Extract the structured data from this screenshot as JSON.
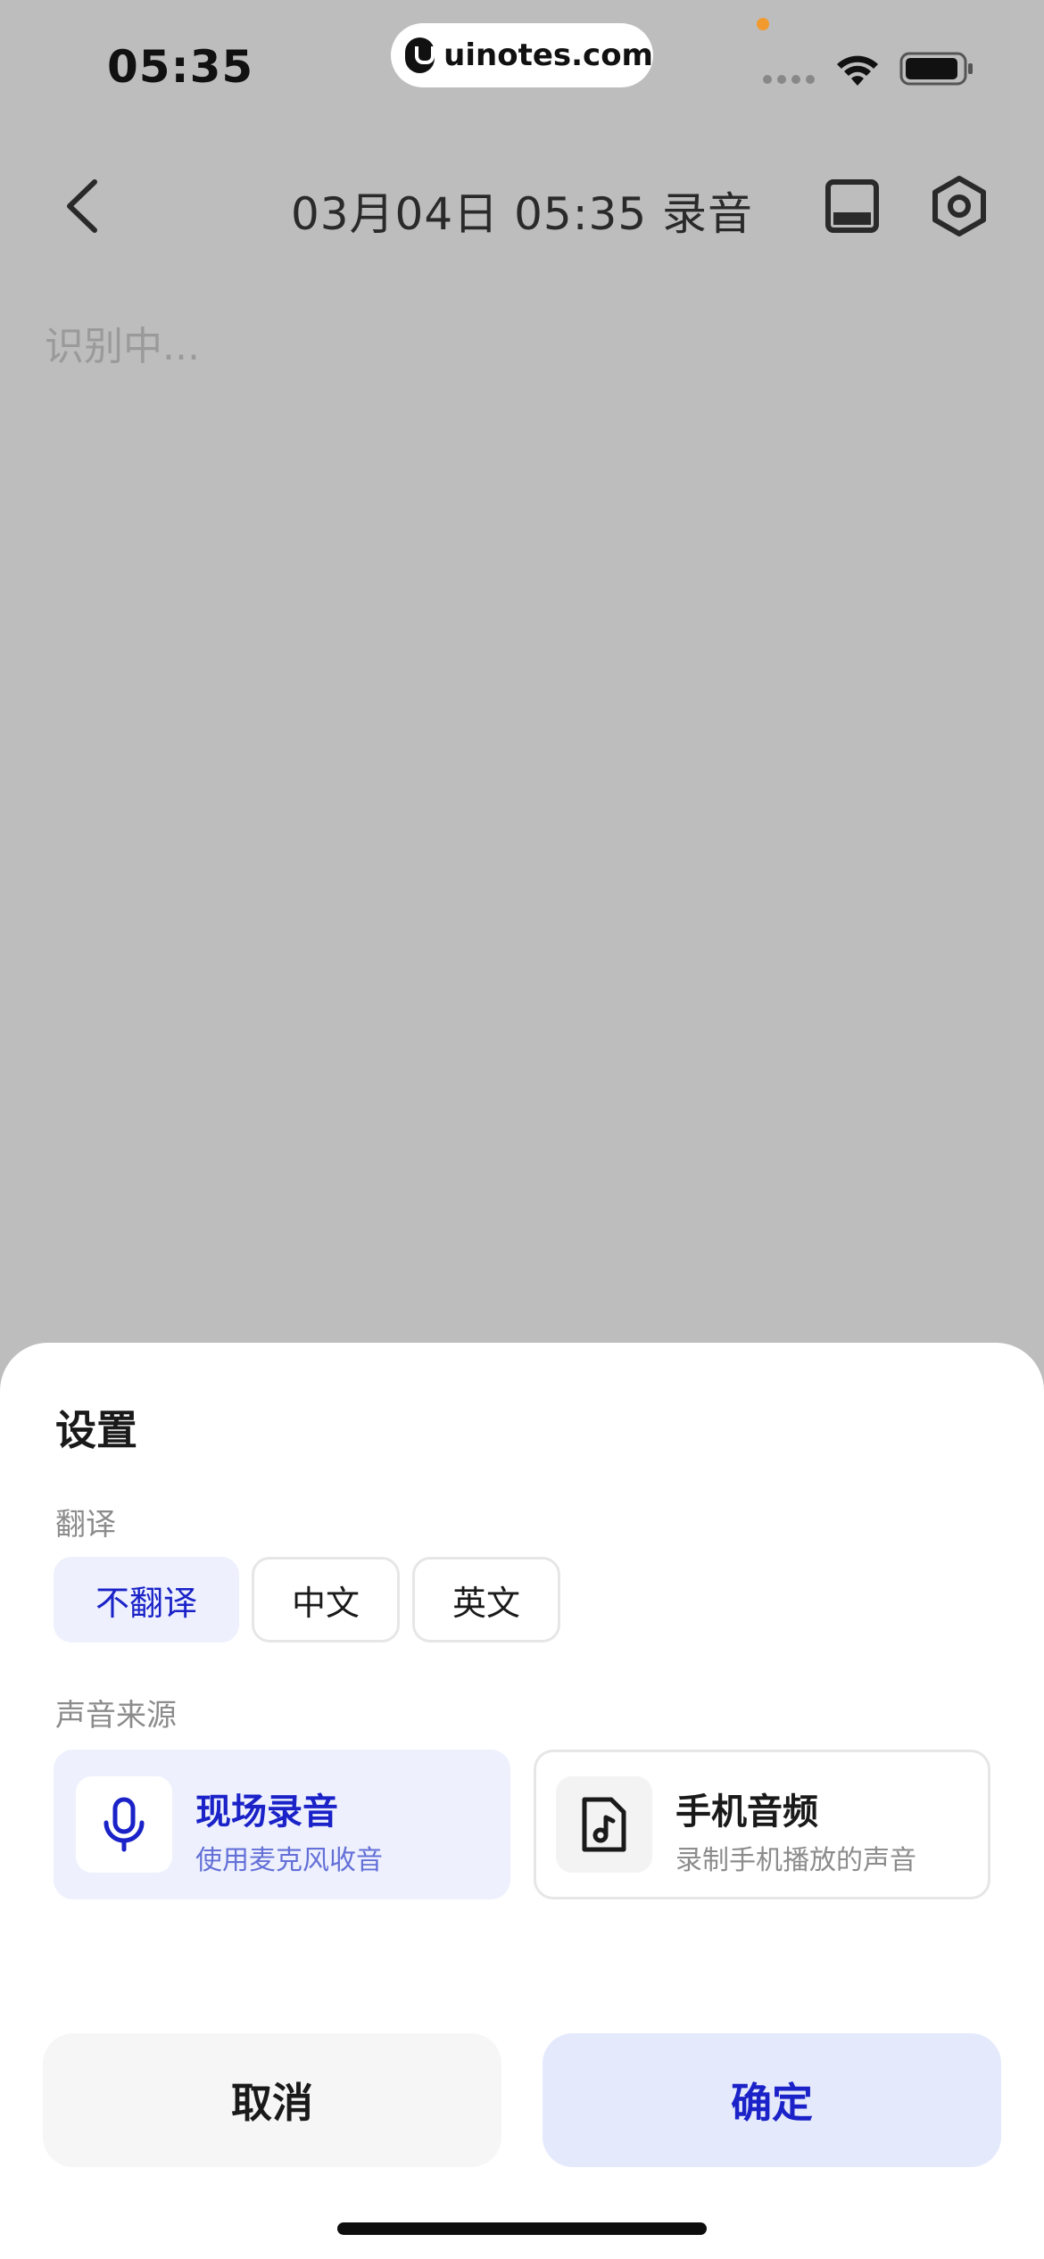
{
  "status_bar": {
    "time": "05:35",
    "watermark": "uinotes.com"
  },
  "nav": {
    "title": "03月04日 05:35 录音"
  },
  "content": {
    "placeholder": "识别中..."
  },
  "sheet": {
    "title": "设置",
    "translate": {
      "label": "翻译",
      "options": [
        {
          "label": "不翻译",
          "selected": true
        },
        {
          "label": "中文",
          "selected": false
        },
        {
          "label": "英文",
          "selected": false
        }
      ]
    },
    "source": {
      "label": "声音来源",
      "options": [
        {
          "title": "现场录音",
          "subtitle": "使用麦克风收音",
          "icon": "microphone-icon",
          "selected": true
        },
        {
          "title": "手机音频",
          "subtitle": "录制手机播放的声音",
          "icon": "music-file-icon",
          "selected": false
        }
      ]
    },
    "cancel_label": "取消",
    "confirm_label": "确定"
  },
  "colors": {
    "accent": "#1a22c8",
    "accent_bg": "#eef1fd",
    "overlay": "#bdbdbd"
  }
}
